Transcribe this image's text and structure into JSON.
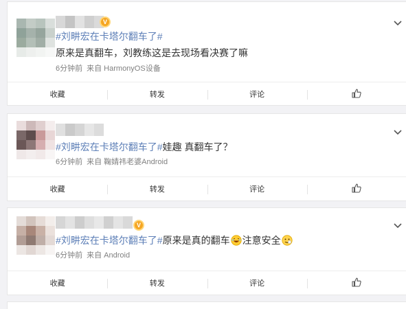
{
  "posts": [
    {
      "hashtag": "#刘畊宏在卡塔尔翻车了#",
      "text": "原来是真翻车，刘教练这是去现场看决赛了嘛",
      "time": "6分钟前",
      "source": "来自 HarmonyOS设备",
      "verified_badge": "V",
      "actions": {
        "favorite": "收藏",
        "repost": "转发",
        "comment": "评论",
        "like_icon": "thumbs-up-icon"
      }
    },
    {
      "hashtag": "#刘畊宏在卡塔尔翻车了#",
      "text": "娃趣 真翻车了？",
      "time": "6分钟前",
      "source": "来自 鞠婧祎老婆Android",
      "actions": {
        "favorite": "收藏",
        "repost": "转发",
        "comment": "评论",
        "like_icon": "thumbs-up-icon"
      }
    },
    {
      "hashtag": "#刘畊宏在卡塔尔翻车了#",
      "text": "原来是真的翻车",
      "text_after_emoji": "注意安全",
      "time": "6分钟前",
      "source": "来自 Android",
      "verified_badge": "V",
      "actions": {
        "favorite": "收藏",
        "repost": "转发",
        "comment": "评论",
        "like_icon": "thumbs-up-icon"
      }
    }
  ],
  "colors": {
    "hashtag": "#5d7fb7",
    "text": "#333333",
    "meta": "#808080",
    "badge": "#f5a623",
    "background": "#f2f2f5"
  }
}
